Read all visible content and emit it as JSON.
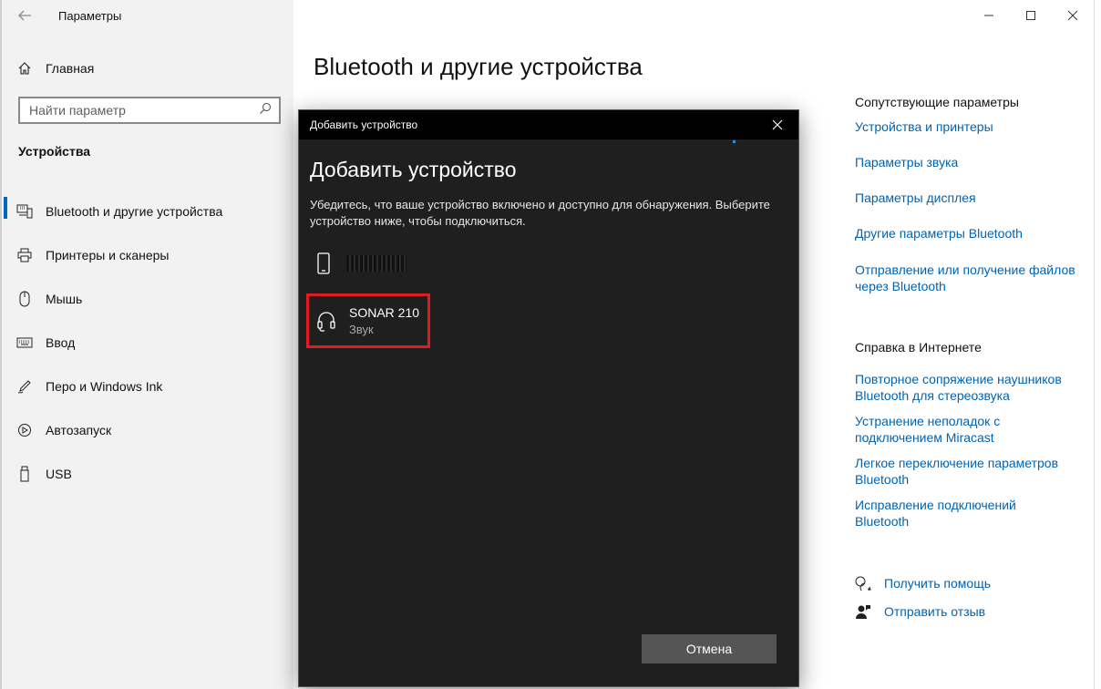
{
  "app": {
    "title": "Параметры"
  },
  "sidebar": {
    "home_label": "Главная",
    "search_placeholder": "Найти параметр",
    "section_heading": "Устройства",
    "items": [
      {
        "label": "Bluetooth и другие устройства",
        "icon": "bluetooth-devices-icon",
        "active": true
      },
      {
        "label": "Принтеры и сканеры",
        "icon": "printer-icon",
        "active": false
      },
      {
        "label": "Мышь",
        "icon": "mouse-icon",
        "active": false
      },
      {
        "label": "Ввод",
        "icon": "keyboard-icon",
        "active": false
      },
      {
        "label": "Перо и Windows Ink",
        "icon": "pen-icon",
        "active": false
      },
      {
        "label": "Автозапуск",
        "icon": "autoplay-icon",
        "active": false
      },
      {
        "label": "USB",
        "icon": "usb-icon",
        "active": false
      }
    ]
  },
  "main": {
    "page_title": "Bluetooth и другие устройства",
    "related_heading": "Сопутствующие параметры",
    "related_links": [
      "Устройства и принтеры",
      "Параметры звука",
      "Параметры дисплея",
      "Другие параметры Bluetooth",
      "Отправление или получение файлов через Bluetooth"
    ],
    "web_help_heading": "Справка в Интернете",
    "web_help_links": [
      "Повторное сопряжение наушников Bluetooth для стереозвука",
      "Устранение неполадок с подключением Miracast",
      "Легкое переключение параметров Bluetooth",
      "Исправление подключений Bluetooth"
    ],
    "get_help": "Получить помощь",
    "send_feedback": "Отправить отзыв"
  },
  "dialog": {
    "window_title": "Добавить устройство",
    "heading": "Добавить устройство",
    "description": "Убедитесь, что ваше устройство включено и доступно для обнаружения. Выберите устройство ниже, чтобы подключиться.",
    "devices": [
      {
        "name": "",
        "subtitle": "",
        "icon": "phone-icon",
        "redacted": true
      },
      {
        "name": "SONAR 210",
        "subtitle": "Звук",
        "icon": "headphones-icon",
        "highlighted": true
      }
    ],
    "cancel_label": "Отмена"
  },
  "colors": {
    "accent": "#0067c0",
    "link": "#0063b1",
    "highlight": "#e11b22",
    "dialog_bg": "#1f1f1f"
  }
}
